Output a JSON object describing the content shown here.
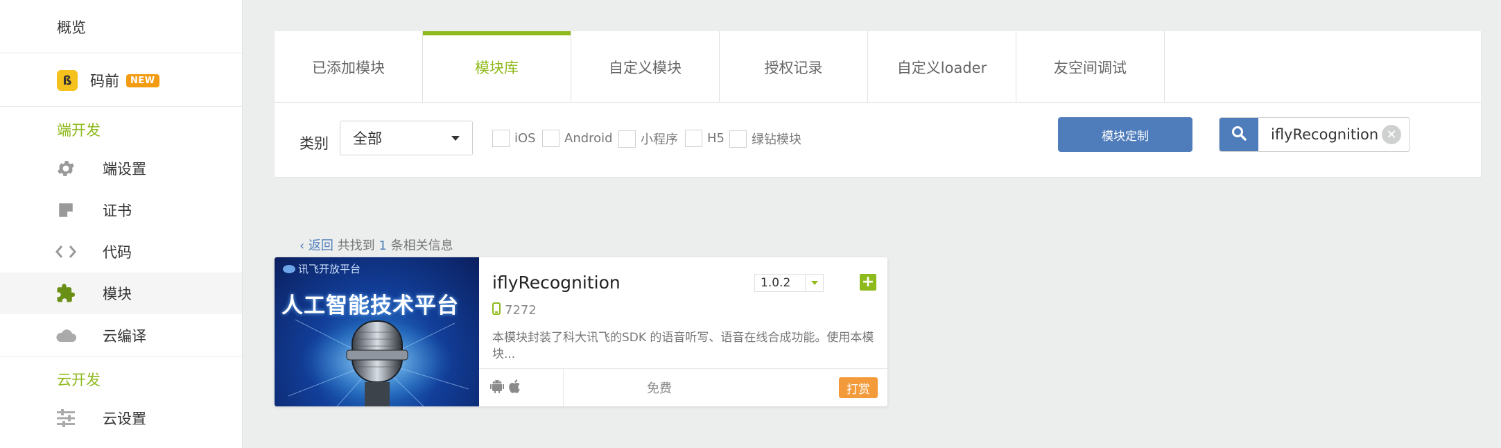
{
  "sidebar": {
    "overview": "概览",
    "maqian": {
      "label": "码前",
      "badge": "NEW"
    },
    "section_client": "端开发",
    "client_items": [
      {
        "label": "端设置",
        "icon": "gear-icon"
      },
      {
        "label": "证书",
        "icon": "certificate-icon"
      },
      {
        "label": "代码",
        "icon": "code-icon"
      },
      {
        "label": "模块",
        "icon": "puzzle-icon"
      },
      {
        "label": "云编译",
        "icon": "cloud-icon"
      }
    ],
    "section_cloud": "云开发",
    "cloud_items": [
      {
        "label": "云设置",
        "icon": "sliders-icon"
      }
    ]
  },
  "tabs": [
    "已添加模块",
    "模块库",
    "自定义模块",
    "授权记录",
    "自定义loader",
    "友空间调试"
  ],
  "active_tab": "模块库",
  "filter": {
    "category_label": "类别",
    "category_value": "全部",
    "checkboxes": [
      "iOS",
      "Android",
      "小程序",
      "H5",
      "绿钻模块"
    ],
    "custom_button": "模块定制",
    "search_value": "iflyRecognition"
  },
  "result": {
    "back": "返回",
    "prefix": "共找到",
    "count": "1",
    "suffix": "条相关信息"
  },
  "module_card": {
    "image_brand": "讯飞开放平台",
    "image_title": "人工智能技术平台",
    "name": "iflyRecognition",
    "downloads": "7272",
    "version": "1.0.2",
    "description": "本模块封装了科大讯飞的SDK 的语音听写、语音在线合成功能。使用本模块...",
    "price": "免费",
    "tip_button": "打赏",
    "platform_icons": [
      "android-icon",
      "apple-icon"
    ]
  },
  "colors": {
    "accent_green": "#8fba1c",
    "button_blue": "#4f7dbb",
    "tip_orange": "#f39a3b",
    "badge_orange": "#f39c12"
  }
}
